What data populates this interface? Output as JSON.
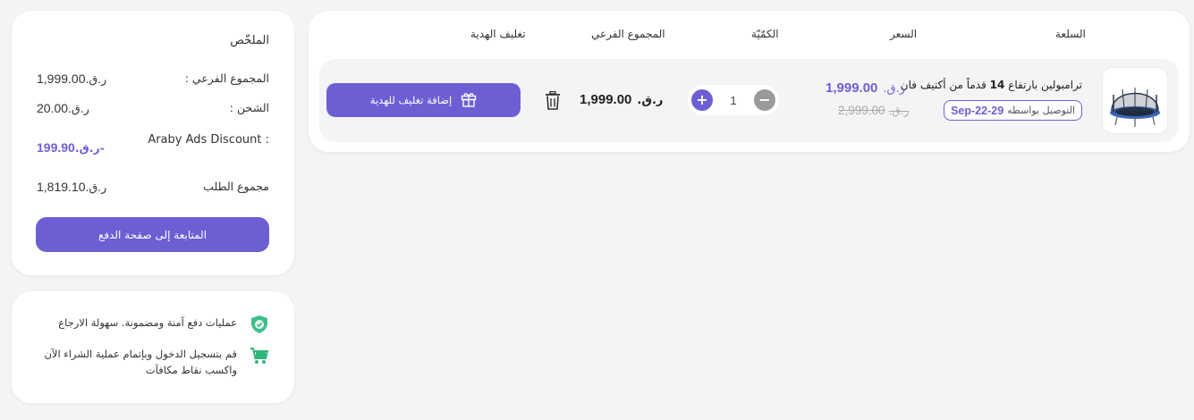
{
  "summary": {
    "title": "الملخّص",
    "rows": [
      {
        "label": "المجموع الفرعي :",
        "currency": "ر.ق.",
        "value": "1,999.00"
      },
      {
        "label": "الشحن :",
        "currency": "ر.ق.",
        "value": "20.00"
      },
      {
        "label": "Araby Ads Discount :",
        "currency": "-ر.ق.",
        "value": "199.90"
      },
      {
        "label": "مجموع الطلب",
        "currency": "ر.ق.",
        "value": "1,819.10"
      }
    ],
    "checkout_label": "المتابعة إلى صفحة الدفع"
  },
  "info": {
    "items": [
      {
        "icon": "shield-check-icon",
        "text": "عمليات دفع آمنة ومضمونة. سهولة الارجاع"
      },
      {
        "icon": "cart-icon",
        "text": "قم بتسجيل الدخول وبإتمام عملية الشراء الآن واكسب نقاط مكافآت"
      }
    ]
  },
  "cart": {
    "headers": {
      "item": "السلعة",
      "price": "السعر",
      "quantity": "الكمّيّة",
      "subtotal": "المجموع الفرعي",
      "gift_wrap": "تغليف الهدية"
    },
    "items": [
      {
        "name_prefix": "ترامبولين بارتفاع",
        "name_bold": "14",
        "name_suffix": "قدماً من أكتيف فان",
        "delivery_prefix": "التوصيل بواسطه",
        "delivery_date": "Sep-22-29",
        "currency": "ر.ق.",
        "price": "1,999.00",
        "old_price": "2,999.00",
        "quantity": "1",
        "subtotal": "1,999.00",
        "gift_label": "إضافة تغليف للهدية"
      }
    ]
  },
  "colors": {
    "accent": "#6c5fd4",
    "background": "#f4f4f6",
    "shield": "#3dbf8a",
    "cart_icon": "#2fb67a"
  }
}
